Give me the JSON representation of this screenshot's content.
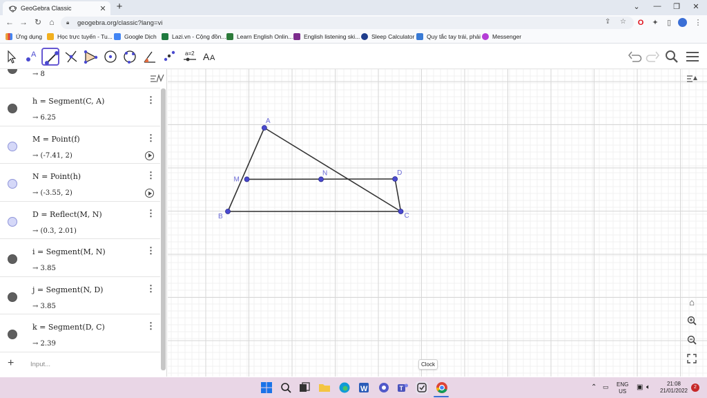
{
  "browser": {
    "tab_title": "GeoGebra Classic",
    "url": "geogebra.org/classic?lang=vi"
  },
  "bookmarks": [
    {
      "label": "Ứng dụng",
      "color": "#e8a33c"
    },
    {
      "label": "Học trực tuyến - Tu...",
      "color": "#f2b01e"
    },
    {
      "label": "Google Dịch",
      "color": "#4285f4"
    },
    {
      "label": "Lazi.vn - Cộng đồn...",
      "color": "#1f7a3f"
    },
    {
      "label": "Learn English Onlin...",
      "color": "#2c7a3a"
    },
    {
      "label": "English listening ski...",
      "color": "#7b2b8c"
    },
    {
      "label": "Sleep Calculator",
      "color": "#1e3c8c"
    },
    {
      "label": "Quy tắc tay trái, phải",
      "color": "#3a7bd5"
    },
    {
      "label": "Messenger",
      "color": "#b43dd6"
    }
  ],
  "algebra": {
    "top_partial_value": "→ 8",
    "rows": [
      {
        "def": "h = Segment(C, A)",
        "value": "→ 6.25",
        "style": "dark",
        "play": false
      },
      {
        "def": "M = Point(f)",
        "value": "→ (-7.41, 2)",
        "style": "light",
        "play": true
      },
      {
        "def": "N = Point(h)",
        "value": "→ (-3.55, 2)",
        "style": "light",
        "play": true
      },
      {
        "def": "D = Reflect(M, N)",
        "value": "→ (0.3, 2.01)",
        "style": "light",
        "play": false
      },
      {
        "def": "i = Segment(M, N)",
        "value": "→ 3.85",
        "style": "dark",
        "play": false
      },
      {
        "def": "j = Segment(N, D)",
        "value": "→ 3.85",
        "style": "dark",
        "play": false
      },
      {
        "def": "k = Segment(D, C)",
        "value": "→ 2.39",
        "style": "dark",
        "play": false
      }
    ],
    "input_placeholder": "Input..."
  },
  "graphics": {
    "point_color": "#4a4ad0",
    "label_color": "#6b6bd6",
    "points": [
      {
        "name": "A",
        "x": -6.5,
        "y": 3.6
      },
      {
        "name": "B",
        "x": -8.4,
        "y": 1.0
      },
      {
        "name": "C",
        "x": 0.6,
        "y": 1.0
      },
      {
        "name": "M",
        "x": -7.41,
        "y": 2.0
      },
      {
        "name": "N",
        "x": -3.55,
        "y": 2.0
      },
      {
        "name": "D",
        "x": 0.3,
        "y": 2.01
      }
    ],
    "segments": [
      [
        "A",
        "B"
      ],
      [
        "B",
        "C"
      ],
      [
        "C",
        "A"
      ],
      [
        "M",
        "D"
      ],
      [
        "D",
        "C"
      ]
    ],
    "tooltip": "Clock"
  },
  "taskbar": {
    "lang": "ENG",
    "region": "US",
    "time": "21:08",
    "date": "21/01/2022",
    "notif_count": "2"
  }
}
